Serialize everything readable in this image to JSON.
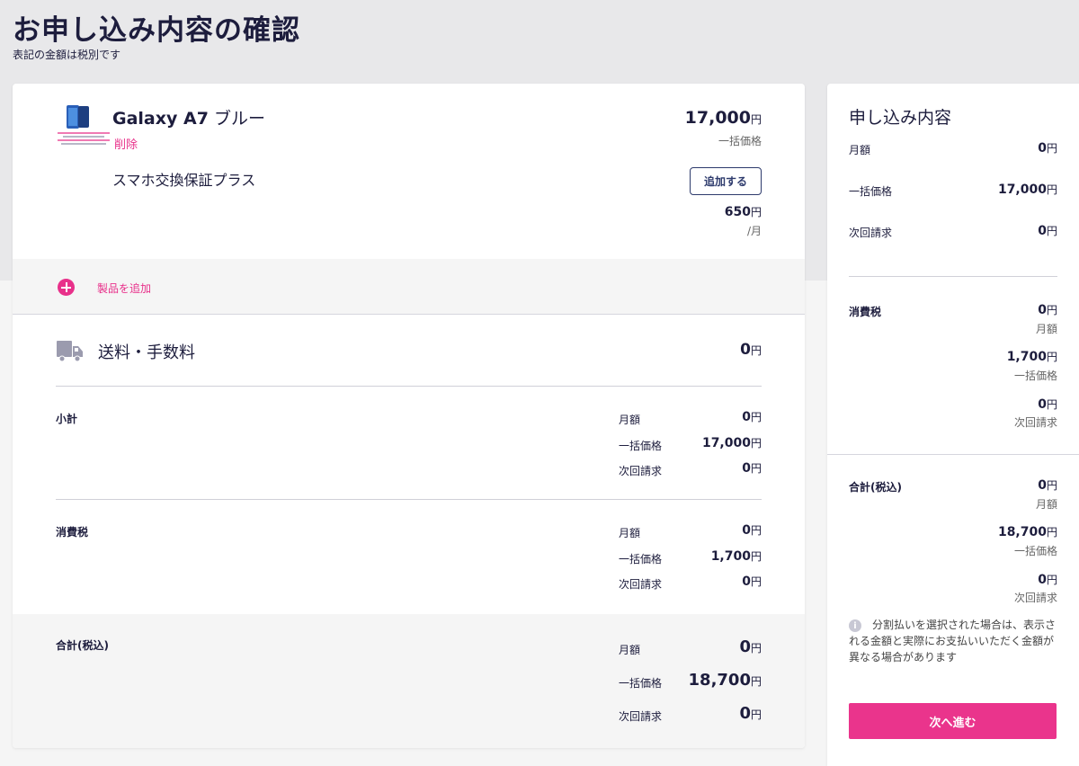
{
  "page": {
    "title": "お申し込み内容の確認",
    "subtitle": "表記の金額は税別です"
  },
  "product": {
    "name_prefix": "Galaxy A7",
    "name_suffix": " ブルー",
    "delete_label": "削除",
    "price": "17,000",
    "price_caption": "一括価格",
    "thumb_text": "Galaxy A7"
  },
  "option": {
    "name": "スマホ交換保証プラス",
    "add_label": "追加する",
    "price": "650",
    "price_caption": "/月"
  },
  "add_product": {
    "label": "製品を追加"
  },
  "shipping": {
    "label": "送料・手数料",
    "value": "0"
  },
  "yen": "円",
  "subtotal": {
    "title": "小計",
    "rows": [
      {
        "label": "月額",
        "value": "0"
      },
      {
        "label": "一括価格",
        "value": "17,000"
      },
      {
        "label": "次回請求",
        "value": "0"
      }
    ]
  },
  "tax": {
    "title": "消費税",
    "rows": [
      {
        "label": "月額",
        "value": "0"
      },
      {
        "label": "一括価格",
        "value": "1,700"
      },
      {
        "label": "次回請求",
        "value": "0"
      }
    ]
  },
  "total": {
    "title": "合計(税込)",
    "rows": [
      {
        "label": "月額",
        "value": "0"
      },
      {
        "label": "一括価格",
        "value": "18,700"
      },
      {
        "label": "次回請求",
        "value": "0"
      }
    ]
  },
  "summary": {
    "title": "申し込み内容",
    "rows": [
      {
        "label": "月額",
        "value": "0"
      },
      {
        "label": "一括価格",
        "value": "17,000"
      },
      {
        "label": "次回請求",
        "value": "0"
      }
    ],
    "tax": {
      "title": "消費税",
      "items": [
        {
          "value": "0",
          "caption": "月額"
        },
        {
          "value": "1,700",
          "caption": "一括価格"
        },
        {
          "value": "0",
          "caption": "次回請求"
        }
      ]
    },
    "total": {
      "title": "合計(税込)",
      "items": [
        {
          "value": "0",
          "caption": "月額"
        },
        {
          "value": "18,700",
          "caption": "一括価格"
        },
        {
          "value": "0",
          "caption": "次回請求"
        }
      ]
    },
    "note": "分割払いを選択された場合は、表示される金額と実際にお支払いいただく金額が異なる場合があります",
    "info_icon_glyph": "i",
    "next_label": "次へ進む"
  },
  "colors": {
    "accent": "#ea348c",
    "navy": "#1d1d3d",
    "button_border": "#2d3a6c"
  }
}
